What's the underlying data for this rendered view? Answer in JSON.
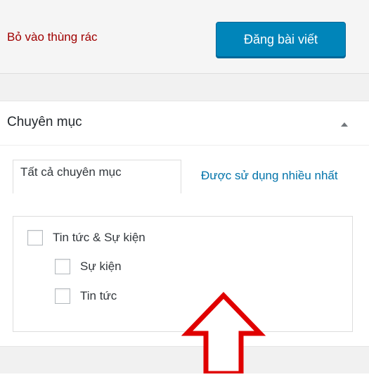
{
  "publish": {
    "trash_label": "Bỏ vào thùng rác",
    "publish_label": "Đăng bài viết"
  },
  "categories": {
    "title": "Chuyên mục",
    "toggle_icon": "triangle-up-icon",
    "tabs": [
      {
        "label": "Tất cả chuyên mục",
        "active": true
      },
      {
        "label": "Được sử dụng nhiều nhất",
        "active": false
      }
    ],
    "items": [
      {
        "label": "Tin tức & Sự kiện",
        "checked": false,
        "level": 0
      },
      {
        "label": "Sự kiện",
        "checked": false,
        "level": 1
      },
      {
        "label": "Tin tức",
        "checked": false,
        "level": 1
      }
    ]
  },
  "annotation": {
    "icon": "red-up-arrow-icon",
    "color": "#e00000"
  },
  "colors": {
    "primary_button": "#0085ba",
    "trash_link": "#a00000",
    "link": "#0073aa"
  }
}
